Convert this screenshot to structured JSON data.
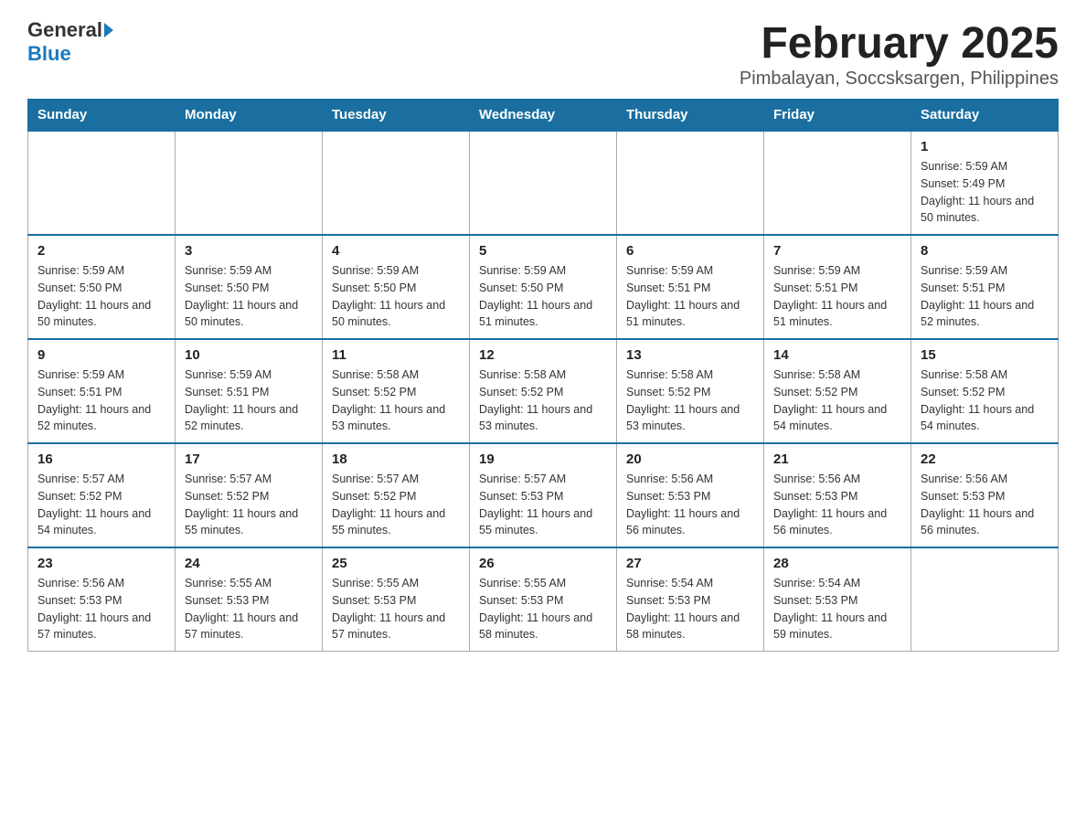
{
  "header": {
    "logo_general": "General",
    "logo_blue": "Blue",
    "month_title": "February 2025",
    "subtitle": "Pimbalayan, Soccsksargen, Philippines"
  },
  "weekdays": [
    "Sunday",
    "Monday",
    "Tuesday",
    "Wednesday",
    "Thursday",
    "Friday",
    "Saturday"
  ],
  "weeks": [
    [
      {
        "day": "",
        "info": ""
      },
      {
        "day": "",
        "info": ""
      },
      {
        "day": "",
        "info": ""
      },
      {
        "day": "",
        "info": ""
      },
      {
        "day": "",
        "info": ""
      },
      {
        "day": "",
        "info": ""
      },
      {
        "day": "1",
        "info": "Sunrise: 5:59 AM\nSunset: 5:49 PM\nDaylight: 11 hours and 50 minutes."
      }
    ],
    [
      {
        "day": "2",
        "info": "Sunrise: 5:59 AM\nSunset: 5:50 PM\nDaylight: 11 hours and 50 minutes."
      },
      {
        "day": "3",
        "info": "Sunrise: 5:59 AM\nSunset: 5:50 PM\nDaylight: 11 hours and 50 minutes."
      },
      {
        "day": "4",
        "info": "Sunrise: 5:59 AM\nSunset: 5:50 PM\nDaylight: 11 hours and 50 minutes."
      },
      {
        "day": "5",
        "info": "Sunrise: 5:59 AM\nSunset: 5:50 PM\nDaylight: 11 hours and 51 minutes."
      },
      {
        "day": "6",
        "info": "Sunrise: 5:59 AM\nSunset: 5:51 PM\nDaylight: 11 hours and 51 minutes."
      },
      {
        "day": "7",
        "info": "Sunrise: 5:59 AM\nSunset: 5:51 PM\nDaylight: 11 hours and 51 minutes."
      },
      {
        "day": "8",
        "info": "Sunrise: 5:59 AM\nSunset: 5:51 PM\nDaylight: 11 hours and 52 minutes."
      }
    ],
    [
      {
        "day": "9",
        "info": "Sunrise: 5:59 AM\nSunset: 5:51 PM\nDaylight: 11 hours and 52 minutes."
      },
      {
        "day": "10",
        "info": "Sunrise: 5:59 AM\nSunset: 5:51 PM\nDaylight: 11 hours and 52 minutes."
      },
      {
        "day": "11",
        "info": "Sunrise: 5:58 AM\nSunset: 5:52 PM\nDaylight: 11 hours and 53 minutes."
      },
      {
        "day": "12",
        "info": "Sunrise: 5:58 AM\nSunset: 5:52 PM\nDaylight: 11 hours and 53 minutes."
      },
      {
        "day": "13",
        "info": "Sunrise: 5:58 AM\nSunset: 5:52 PM\nDaylight: 11 hours and 53 minutes."
      },
      {
        "day": "14",
        "info": "Sunrise: 5:58 AM\nSunset: 5:52 PM\nDaylight: 11 hours and 54 minutes."
      },
      {
        "day": "15",
        "info": "Sunrise: 5:58 AM\nSunset: 5:52 PM\nDaylight: 11 hours and 54 minutes."
      }
    ],
    [
      {
        "day": "16",
        "info": "Sunrise: 5:57 AM\nSunset: 5:52 PM\nDaylight: 11 hours and 54 minutes."
      },
      {
        "day": "17",
        "info": "Sunrise: 5:57 AM\nSunset: 5:52 PM\nDaylight: 11 hours and 55 minutes."
      },
      {
        "day": "18",
        "info": "Sunrise: 5:57 AM\nSunset: 5:52 PM\nDaylight: 11 hours and 55 minutes."
      },
      {
        "day": "19",
        "info": "Sunrise: 5:57 AM\nSunset: 5:53 PM\nDaylight: 11 hours and 55 minutes."
      },
      {
        "day": "20",
        "info": "Sunrise: 5:56 AM\nSunset: 5:53 PM\nDaylight: 11 hours and 56 minutes."
      },
      {
        "day": "21",
        "info": "Sunrise: 5:56 AM\nSunset: 5:53 PM\nDaylight: 11 hours and 56 minutes."
      },
      {
        "day": "22",
        "info": "Sunrise: 5:56 AM\nSunset: 5:53 PM\nDaylight: 11 hours and 56 minutes."
      }
    ],
    [
      {
        "day": "23",
        "info": "Sunrise: 5:56 AM\nSunset: 5:53 PM\nDaylight: 11 hours and 57 minutes."
      },
      {
        "day": "24",
        "info": "Sunrise: 5:55 AM\nSunset: 5:53 PM\nDaylight: 11 hours and 57 minutes."
      },
      {
        "day": "25",
        "info": "Sunrise: 5:55 AM\nSunset: 5:53 PM\nDaylight: 11 hours and 57 minutes."
      },
      {
        "day": "26",
        "info": "Sunrise: 5:55 AM\nSunset: 5:53 PM\nDaylight: 11 hours and 58 minutes."
      },
      {
        "day": "27",
        "info": "Sunrise: 5:54 AM\nSunset: 5:53 PM\nDaylight: 11 hours and 58 minutes."
      },
      {
        "day": "28",
        "info": "Sunrise: 5:54 AM\nSunset: 5:53 PM\nDaylight: 11 hours and 59 minutes."
      },
      {
        "day": "",
        "info": ""
      }
    ]
  ]
}
